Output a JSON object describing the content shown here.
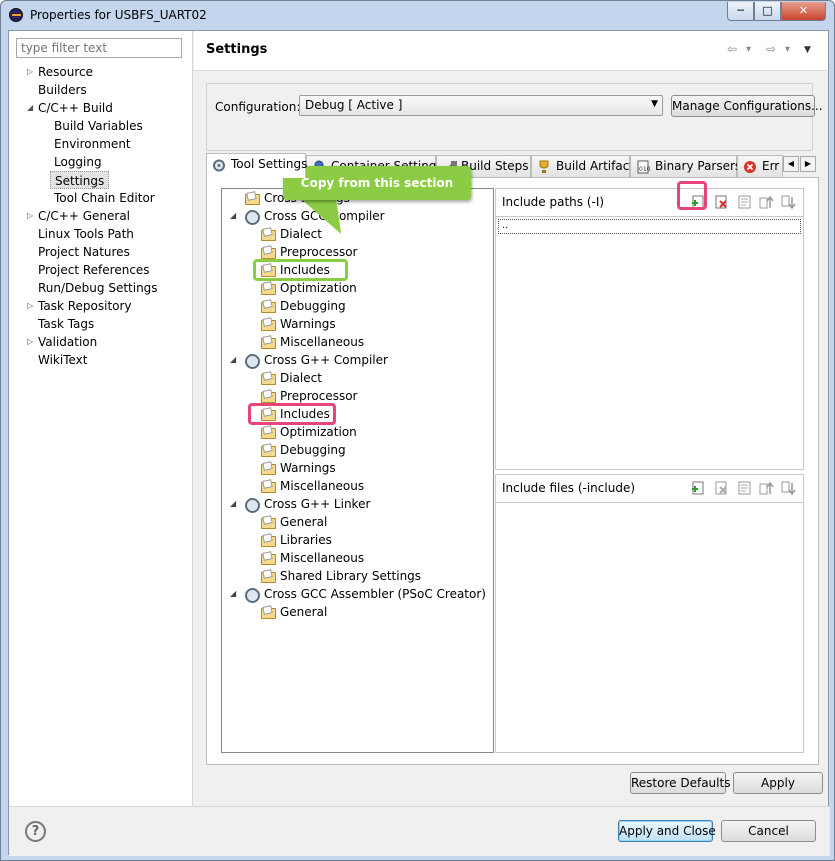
{
  "window": {
    "title": "Properties for USBFS_UART02",
    "minimize_glyph": "─",
    "maximize_glyph": "□",
    "close_glyph": "✕"
  },
  "left": {
    "filter_placeholder": "type filter text",
    "items": [
      {
        "label": "Resource",
        "toggle": "▷"
      },
      {
        "label": "Builders",
        "toggle": ""
      },
      {
        "label": "C/C++ Build",
        "toggle": "◢"
      },
      {
        "label": "Build Variables",
        "toggle": ""
      },
      {
        "label": "Environment",
        "toggle": ""
      },
      {
        "label": "Logging",
        "toggle": ""
      },
      {
        "label": "Settings",
        "toggle": ""
      },
      {
        "label": "Tool Chain Editor",
        "toggle": ""
      },
      {
        "label": "C/C++ General",
        "toggle": "▷"
      },
      {
        "label": "Linux Tools Path",
        "toggle": ""
      },
      {
        "label": "Project Natures",
        "toggle": ""
      },
      {
        "label": "Project References",
        "toggle": ""
      },
      {
        "label": "Run/Debug Settings",
        "toggle": ""
      },
      {
        "label": "Task Repository",
        "toggle": "▷"
      },
      {
        "label": "Task Tags",
        "toggle": ""
      },
      {
        "label": "Validation",
        "toggle": "▷"
      },
      {
        "label": "WikiText",
        "toggle": ""
      }
    ]
  },
  "header": {
    "title": "Settings",
    "back_glyph": "⇦",
    "forward_glyph": "⇨",
    "dropdown_glyph": "▾",
    "menu_glyph": "▼"
  },
  "config": {
    "label": "Configuration:",
    "value": "Debug  [ Active ]",
    "dropdown_glyph": "▼",
    "manage_label": "Manage Configurations..."
  },
  "tabs": [
    {
      "label": "Tool Settings",
      "icon": "tool-settings-icon"
    },
    {
      "label": "Container Settings",
      "icon": "container-icon"
    },
    {
      "label": "Build Steps",
      "icon": "build-steps-icon"
    },
    {
      "label": "Build Artifact",
      "icon": "trophy-icon"
    },
    {
      "label": "Binary Parsers",
      "icon": "binary-icon"
    },
    {
      "label": "Err",
      "icon": "error-icon"
    }
  ],
  "tab_scroll": {
    "left": "◀",
    "right": "▶"
  },
  "tree": [
    {
      "label": "Cross Settings",
      "toggle": "",
      "icon": "folder"
    },
    {
      "label": "Cross GCC Compiler",
      "toggle": "◢",
      "icon": "gear"
    },
    {
      "label": "Dialect",
      "toggle": "",
      "icon": "folder"
    },
    {
      "label": "Preprocessor",
      "toggle": "",
      "icon": "folder"
    },
    {
      "label": "Includes",
      "toggle": "",
      "icon": "folder"
    },
    {
      "label": "Optimization",
      "toggle": "",
      "icon": "folder"
    },
    {
      "label": "Debugging",
      "toggle": "",
      "icon": "folder"
    },
    {
      "label": "Warnings",
      "toggle": "",
      "icon": "folder"
    },
    {
      "label": "Miscellaneous",
      "toggle": "",
      "icon": "folder"
    },
    {
      "label": "Cross G++ Compiler",
      "toggle": "◢",
      "icon": "gear"
    },
    {
      "label": "Dialect",
      "toggle": "",
      "icon": "folder"
    },
    {
      "label": "Preprocessor",
      "toggle": "",
      "icon": "folder"
    },
    {
      "label": "Includes",
      "toggle": "",
      "icon": "folder"
    },
    {
      "label": "Optimization",
      "toggle": "",
      "icon": "folder"
    },
    {
      "label": "Debugging",
      "toggle": "",
      "icon": "folder"
    },
    {
      "label": "Warnings",
      "toggle": "",
      "icon": "folder"
    },
    {
      "label": "Miscellaneous",
      "toggle": "",
      "icon": "folder"
    },
    {
      "label": "Cross G++ Linker",
      "toggle": "◢",
      "icon": "gear"
    },
    {
      "label": "General",
      "toggle": "",
      "icon": "folder"
    },
    {
      "label": "Libraries",
      "toggle": "",
      "icon": "folder"
    },
    {
      "label": "Miscellaneous",
      "toggle": "",
      "icon": "folder"
    },
    {
      "label": "Shared Library Settings",
      "toggle": "",
      "icon": "folder"
    },
    {
      "label": "Cross GCC Assembler (PSoC Creator)",
      "toggle": "◢",
      "icon": "gear"
    },
    {
      "label": "General",
      "toggle": "",
      "icon": "folder"
    }
  ],
  "callout": {
    "text": "Copy from this section"
  },
  "include_paths": {
    "title": "Include paths (-I)",
    "selected_item": "..",
    "icons": [
      "add-icon",
      "delete-icon",
      "edit-icon",
      "move-up-icon",
      "move-down-icon"
    ]
  },
  "include_files": {
    "title": "Include files (-include)",
    "icons": [
      "add-icon",
      "delete-icon",
      "edit-icon",
      "move-up-icon",
      "move-down-icon"
    ]
  },
  "buttons": {
    "restore_defaults": "Restore Defaults",
    "apply": "Apply",
    "apply_and_close": "Apply and Close",
    "cancel": "Cancel",
    "help": "?"
  },
  "colors": {
    "callout_green": "#8ccc45",
    "highlight_pink": "#e7457a"
  }
}
